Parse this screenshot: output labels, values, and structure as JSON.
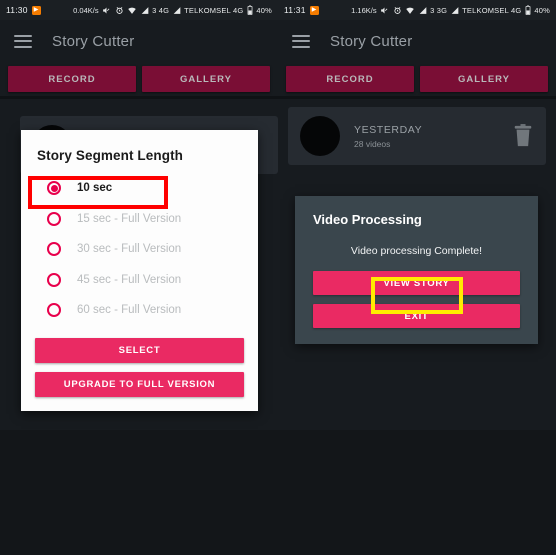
{
  "left_phone": {
    "status_bar": {
      "time": "11:30",
      "app_icon": "app-notification-icon",
      "net_speed": "0.04K/s",
      "icons": [
        "mute-icon",
        "alarm-icon",
        "wifi-icon",
        "signal-icon"
      ],
      "network": "3 4G",
      "carrier": "TELKOMSEL 4G",
      "battery": "40%"
    },
    "app_bar": {
      "menu_icon": "hamburger-menu-icon",
      "title": "Story Cutter"
    },
    "tabs": [
      {
        "label": "RECORD"
      },
      {
        "label": "GALLERY"
      }
    ],
    "dialog": {
      "title": "Story Segment Length",
      "options": [
        {
          "label": "10 sec",
          "selected": true
        },
        {
          "label": "15 sec - Full Version",
          "selected": false
        },
        {
          "label": "30 sec - Full Version",
          "selected": false
        },
        {
          "label": "45 sec - Full Version",
          "selected": false
        },
        {
          "label": "60 sec - Full Version",
          "selected": false
        }
      ],
      "select_label": "SELECT",
      "upgrade_label": "UPGRADE TO FULL VERSION"
    },
    "highlight": {
      "color": "#ff0000",
      "target": "10 sec"
    }
  },
  "right_phone": {
    "status_bar": {
      "time": "11:31",
      "app_icon": "app-notification-icon",
      "net_speed": "1.16K/s",
      "icons": [
        "mute-icon",
        "alarm-icon",
        "wifi-icon",
        "signal-icon"
      ],
      "network": "3 3G",
      "carrier": "TELKOMSEL 4G",
      "battery": "40%"
    },
    "app_bar": {
      "menu_icon": "hamburger-menu-icon",
      "title": "Story Cutter"
    },
    "tabs": [
      {
        "label": "RECORD"
      },
      {
        "label": "GALLERY"
      }
    ],
    "video_item": {
      "title": "YESTERDAY",
      "subtitle": "28 videos",
      "delete_icon": "trash-icon"
    },
    "dialog": {
      "title": "Video Processing",
      "message": "Video processing Complete!",
      "view_label": "VIEW STORY",
      "exit_label": "EXIT"
    },
    "highlight": {
      "color": "#ffec00",
      "target": "VIEW STORY"
    }
  },
  "theme": {
    "accent_pink": "#ea2a63",
    "tab_maroon": "#7a0e35",
    "background": "#131619",
    "pane_background": "#171b1f",
    "dark_dialog": "#3a464d"
  }
}
